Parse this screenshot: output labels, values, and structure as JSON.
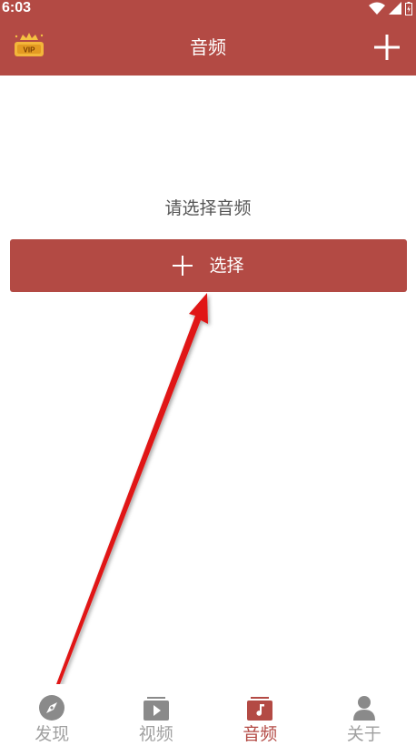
{
  "status_bar": {
    "time": "6:03"
  },
  "toolbar": {
    "title": "音频",
    "vip_badge_text": "VIP",
    "vip_icon": "vip-crown-icon",
    "add_icon": "plus-icon"
  },
  "main": {
    "prompt": "请选择音频",
    "select_button_label": "选择"
  },
  "bottom_nav": {
    "items": [
      {
        "label": "发现",
        "icon": "compass-icon",
        "active": false
      },
      {
        "label": "视频",
        "icon": "video-icon",
        "active": false
      },
      {
        "label": "音频",
        "icon": "music-icon",
        "active": true
      },
      {
        "label": "关于",
        "icon": "person-icon",
        "active": false
      }
    ]
  },
  "colors": {
    "brand": "#b34a44",
    "inactive": "#a0a0a0",
    "annotation_arrow": "#e01818"
  }
}
